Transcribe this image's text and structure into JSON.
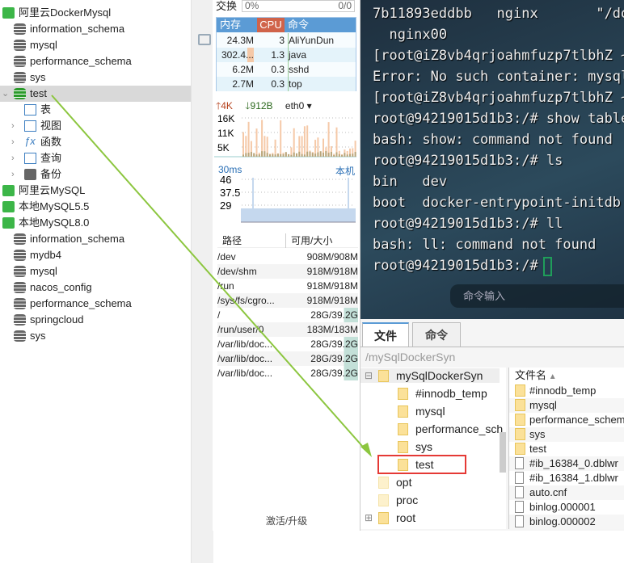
{
  "nav": {
    "items": [
      {
        "label": "阿里云DockerMysql",
        "icon": "mysql-connection-icon",
        "level": 0
      },
      {
        "label": "information_schema",
        "icon": "database-icon",
        "level": 1
      },
      {
        "label": "mysql",
        "icon": "database-icon",
        "level": 1
      },
      {
        "label": "performance_schema",
        "icon": "database-icon",
        "level": 1
      },
      {
        "label": "sys",
        "icon": "database-icon",
        "level": 1
      },
      {
        "label": "test",
        "icon": "database-open-icon",
        "level": 1,
        "selected": true,
        "expanded": true
      },
      {
        "label": "表",
        "icon": "table-icon",
        "level": 2
      },
      {
        "label": "视图",
        "icon": "view-icon",
        "level": 2
      },
      {
        "label": "函数",
        "icon": "function-icon",
        "level": 2
      },
      {
        "label": "查询",
        "icon": "query-icon",
        "level": 2
      },
      {
        "label": "备份",
        "icon": "backup-icon",
        "level": 2
      },
      {
        "label": "阿里云MySQL",
        "icon": "mysql-connection-icon",
        "level": 0
      },
      {
        "label": "本地MySQL5.5",
        "icon": "mysql-connection-icon",
        "level": 0
      },
      {
        "label": "本地MySQL8.0",
        "icon": "mysql-connection-icon",
        "level": 0
      },
      {
        "label": "information_schema",
        "icon": "database-icon",
        "level": 1
      },
      {
        "label": "mydb4",
        "icon": "database-icon",
        "level": 1
      },
      {
        "label": "mysql",
        "icon": "database-icon",
        "level": 1
      },
      {
        "label": "nacos_config",
        "icon": "database-icon",
        "level": 1
      },
      {
        "label": "performance_schema",
        "icon": "database-icon",
        "level": 1
      },
      {
        "label": "springcloud",
        "icon": "database-icon",
        "level": 1
      },
      {
        "label": "sys",
        "icon": "database-icon",
        "level": 1
      }
    ]
  },
  "monitor": {
    "swap_label": "交换",
    "swap_percent": "0%",
    "swap_value": "0/0",
    "proc_headers": [
      "内存",
      "CPU",
      "命令"
    ],
    "procs": [
      [
        "24.3M",
        "3",
        "AliYunDun"
      ],
      [
        "302.4...",
        "1.3",
        "java"
      ],
      [
        "6.2M",
        "0.3",
        "sshd"
      ],
      [
        "2.7M",
        "0.3",
        "top"
      ]
    ],
    "net_up": "4K",
    "net_down": "912B",
    "net_iface": "eth0",
    "net_ticks": [
      "16K",
      "11K",
      "5K"
    ],
    "ping_label": "30ms",
    "ping_host": "本机",
    "ping_ticks": [
      "46",
      "37.5",
      "29"
    ],
    "disk_headers": [
      "路径",
      "可用/大小"
    ],
    "disks": [
      [
        "/dev",
        "908M/908M",
        0
      ],
      [
        "/dev/shm",
        "918M/918M",
        0
      ],
      [
        "/run",
        "918M/918M",
        0
      ],
      [
        "/sys/fs/cgro...",
        "918M/918M",
        0
      ],
      [
        "/",
        "28G/39.2G",
        28
      ],
      [
        "/run/user/0",
        "183M/183M",
        0
      ],
      [
        "/var/lib/doc...",
        "28G/39.2G",
        28
      ],
      [
        "/var/lib/doc...",
        "28G/39.2G",
        28
      ],
      [
        "/var/lib/doc...",
        "28G/39.2G",
        28
      ]
    ],
    "activate": "激活/升级"
  },
  "terminal": {
    "lines": [
      "7b11893eddbb   nginx       \"/do",
      "  nginx00",
      "[root@iZ8vb4qrjoahmfuzp7tlbhZ ~",
      "Error: No such container: mysql",
      "[root@iZ8vb4qrjoahmfuzp7tlbhZ ~",
      "root@94219015d1b3:/# show table",
      "bash: show: command not found",
      "root@94219015d1b3:/# ls",
      "bin   dev",
      "boot  docker-entrypoint-initdb.",
      "root@94219015d1b3:/# ll",
      "bash: ll: command not found",
      "root@94219015d1b3:/# "
    ],
    "input_placeholder": "命令输入"
  },
  "files": {
    "tabs": [
      "文件",
      "命令"
    ],
    "path": "/mySqlDockerSyn",
    "tree": [
      {
        "label": "mySqlDockerSyn",
        "level": 0,
        "expander": "⊟"
      },
      {
        "label": "#innodb_temp",
        "level": 1
      },
      {
        "label": "mysql",
        "level": 1
      },
      {
        "label": "performance_sch",
        "level": 1
      },
      {
        "label": "sys",
        "level": 1
      },
      {
        "label": "test",
        "level": 1,
        "highlighted": true
      },
      {
        "label": "opt",
        "level": 0,
        "faded": true
      },
      {
        "label": "proc",
        "level": 0,
        "faded": true
      },
      {
        "label": "root",
        "level": 0,
        "expander": "⊞"
      }
    ],
    "list_header": "文件名",
    "list": [
      {
        "name": "#innodb_temp",
        "type": "folder"
      },
      {
        "name": "mysql",
        "type": "folder"
      },
      {
        "name": "performance_schem",
        "type": "folder"
      },
      {
        "name": "sys",
        "type": "folder"
      },
      {
        "name": "test",
        "type": "folder"
      },
      {
        "name": "#ib_16384_0.dblwr",
        "type": "file"
      },
      {
        "name": "#ib_16384_1.dblwr",
        "type": "file"
      },
      {
        "name": "auto.cnf",
        "type": "file"
      },
      {
        "name": "binlog.000001",
        "type": "file"
      },
      {
        "name": "binlog.000002",
        "type": "file"
      }
    ]
  },
  "colors": {
    "accent": "#5b9bd5",
    "cpu_header": "#d0634a",
    "highlight_box": "#e53935",
    "arrow": "#8cc63f",
    "terminal_cursor": "#1f9e5a"
  }
}
